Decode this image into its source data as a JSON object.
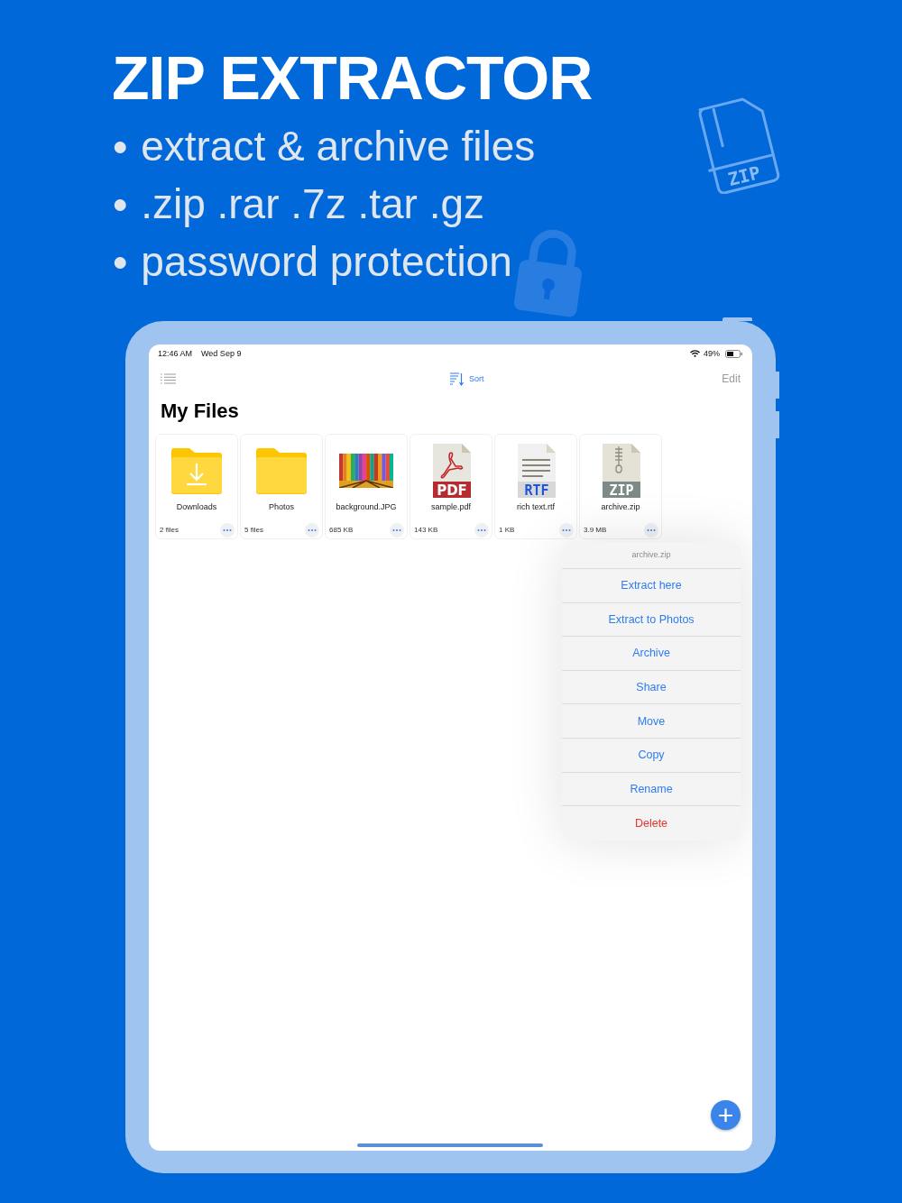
{
  "headline": "ZIP EXTRACTOR",
  "bullets": [
    {
      "mark": "●",
      "text": "extract & archive files"
    },
    {
      "mark": "●",
      "text": ".zip .rar .7z .tar .gz"
    },
    {
      "mark": "●",
      "text": "password protection"
    }
  ],
  "decor_label": "ZIP",
  "status_bar": {
    "time": "12:46 AM",
    "date": "Wed Sep 9",
    "battery": "49%"
  },
  "toolbar": {
    "sort": "Sort",
    "edit": "Edit"
  },
  "title": "My Files",
  "files": [
    {
      "kind": "download-folder",
      "name": "Downloads",
      "info": "2 files"
    },
    {
      "kind": "folder",
      "name": "Photos",
      "info": "5 files"
    },
    {
      "kind": "picture",
      "name": "background.JPG",
      "info": "685 KB"
    },
    {
      "kind": "pdf",
      "name": "sample.pdf",
      "info": "143 KB",
      "icon_label": "PDF"
    },
    {
      "kind": "rtf",
      "name": "rich text.rtf",
      "info": "1 KB",
      "icon_label": "RTF"
    },
    {
      "kind": "zip",
      "name": "archive.zip",
      "info": "3.9 MB",
      "icon_label": "ZIP"
    }
  ],
  "menu": {
    "title": "archive.zip",
    "items": [
      {
        "label": "Extract here",
        "kind": "normal"
      },
      {
        "label": "Extract to Photos",
        "kind": "normal"
      },
      {
        "label": "Archive",
        "kind": "normal"
      },
      {
        "label": "Share",
        "kind": "normal"
      },
      {
        "label": "Move",
        "kind": "normal"
      },
      {
        "label": "Copy",
        "kind": "normal"
      },
      {
        "label": "Rename",
        "kind": "normal"
      },
      {
        "label": "Delete",
        "kind": "destructive"
      }
    ]
  },
  "add_button": "+"
}
